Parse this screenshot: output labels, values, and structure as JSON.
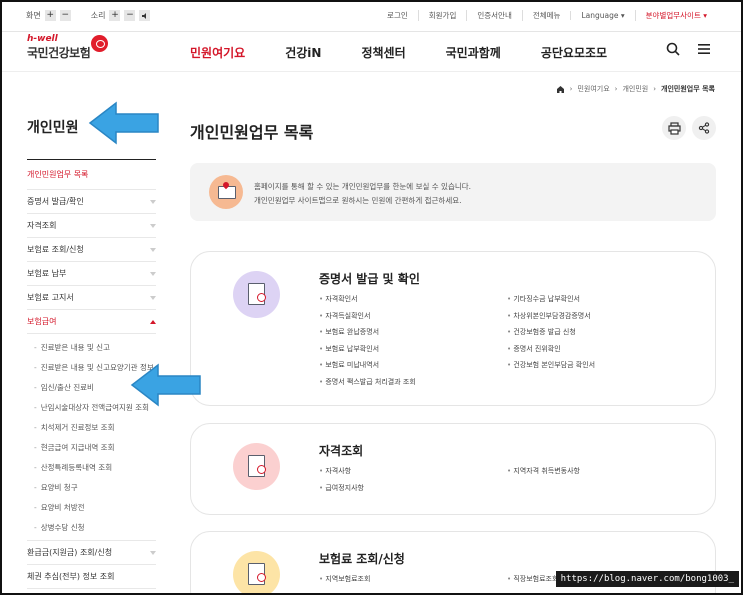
{
  "utility": {
    "screen_label": "화면",
    "sound_label": "소리",
    "plus": "+",
    "minus": "−",
    "links": [
      "로그인",
      "회원가입",
      "인증서안내",
      "전체메뉴",
      "Language ▾",
      "분야별업무사이트 ▾"
    ]
  },
  "logo": {
    "tagline": "h-well",
    "name": "국민건강보험"
  },
  "gnb": [
    "민원여기요",
    "건강iN",
    "정책센터",
    "국민과함께",
    "공단요모조모"
  ],
  "breadcrumb": [
    "민원여기요",
    "개인민원",
    "개인민원업무 목록"
  ],
  "sidebar": {
    "title": "개인민원",
    "items_top": [
      "개인민원업무 목록",
      "증명서 발급/확인",
      "자격조회",
      "보험료 조회/신청",
      "보험료 납부",
      "보험료 고지서",
      "보험급여"
    ],
    "sub_items": [
      "진료받은 내용 및 신고",
      "진료받은 내용 및 신고요양기관 정보",
      "임신/출산 진료비",
      "난임시술대상자 전액급여지원 조회",
      "치석제거 진료정보 조회",
      "현금급여 지급내역 조회",
      "산정특례등록내역 조회",
      "요양비 청구",
      "요양비 처방전",
      "상병수당 신청"
    ],
    "items_bottom": [
      "환급금(지원금) 조회/신청",
      "체권 추심(전부) 정보 조회"
    ]
  },
  "main": {
    "title": "개인민원업무 목록",
    "info_lines": [
      "홈페이지를 통해 할 수 있는 개인민원업무를 한눈에 보실 수 있습니다.",
      "개인민원업무 사이트맵으로 원하시는 민원에 간편하게 접근하세요."
    ],
    "cards": [
      {
        "title": "증명서 발급 및 확인",
        "left": [
          "자격확인서",
          "자격득실확인서",
          "보험료 완납증명서",
          "보험료 납부확인서",
          "보험료 미납내역서",
          "증명서 팩스발급 처리결과 조회"
        ],
        "right": [
          "기타징수금 납부확인서",
          "차상위본인부담경감증명서",
          "건강보험증 발급 신청",
          "증명서 진위확인",
          "건강보험 본인부담금 확인서"
        ]
      },
      {
        "title": "자격조회",
        "left": [
          "자격사항",
          "급여정지사항"
        ],
        "right": [
          "지역자격 취득변동사항"
        ]
      },
      {
        "title": "보험료 조회/신청",
        "left": [
          "지역보험료조회"
        ],
        "right": [
          "직장보험료조회"
        ]
      }
    ]
  },
  "watermark": "https://blog.naver.com/bong1003_",
  "colors": {
    "accent": "#d4172a",
    "arrow": "#3aa3e3"
  }
}
